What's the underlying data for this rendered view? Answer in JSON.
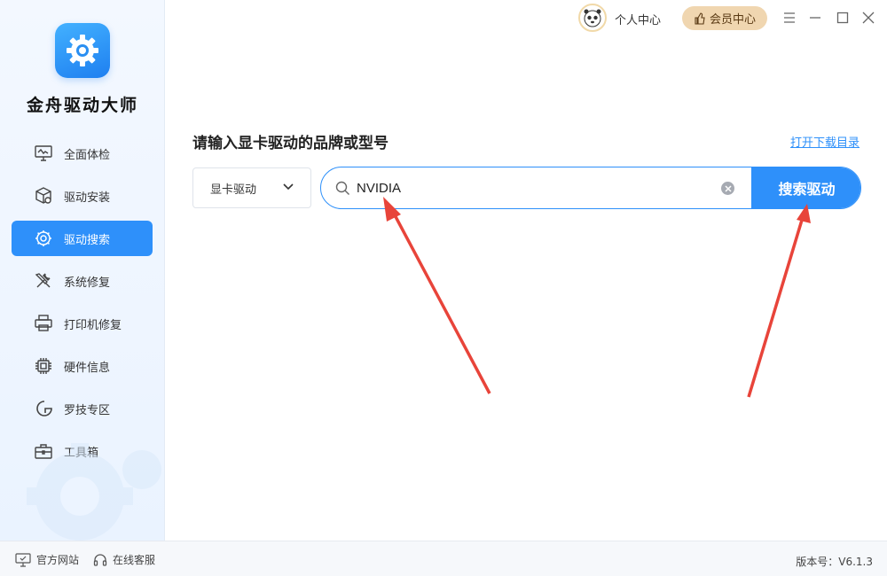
{
  "app": {
    "title": "金舟驱动大师"
  },
  "sidebar": {
    "items": [
      {
        "label": "全面体检",
        "icon": "monitor-check-icon",
        "active": false
      },
      {
        "label": "驱动安装",
        "icon": "box-gear-icon",
        "active": false
      },
      {
        "label": "驱动搜索",
        "icon": "gear-search-icon",
        "active": true
      },
      {
        "label": "系统修复",
        "icon": "tools-icon",
        "active": false
      },
      {
        "label": "打印机修复",
        "icon": "printer-icon",
        "active": false
      },
      {
        "label": "硬件信息",
        "icon": "chip-icon",
        "active": false
      },
      {
        "label": "罗技专区",
        "icon": "logitech-icon",
        "active": false
      },
      {
        "label": "工具箱",
        "icon": "toolbox-icon",
        "active": false
      }
    ]
  },
  "topbar": {
    "user_center": "个人中心",
    "vip_center": "会员中心"
  },
  "main": {
    "heading": "请输入显卡驱动的品牌或型号",
    "open_catalog": "打开下载目录",
    "category_select": {
      "value": "显卡驱动"
    },
    "search": {
      "value": "NVIDIA",
      "button": "搜索驱动"
    }
  },
  "footer": {
    "website": "官方网站",
    "support": "在线客服",
    "version": "版本号：V6.1.3"
  },
  "colors": {
    "accent": "#2e90fa",
    "vip": "#f0d6b0",
    "arrow": "#e8443a"
  }
}
